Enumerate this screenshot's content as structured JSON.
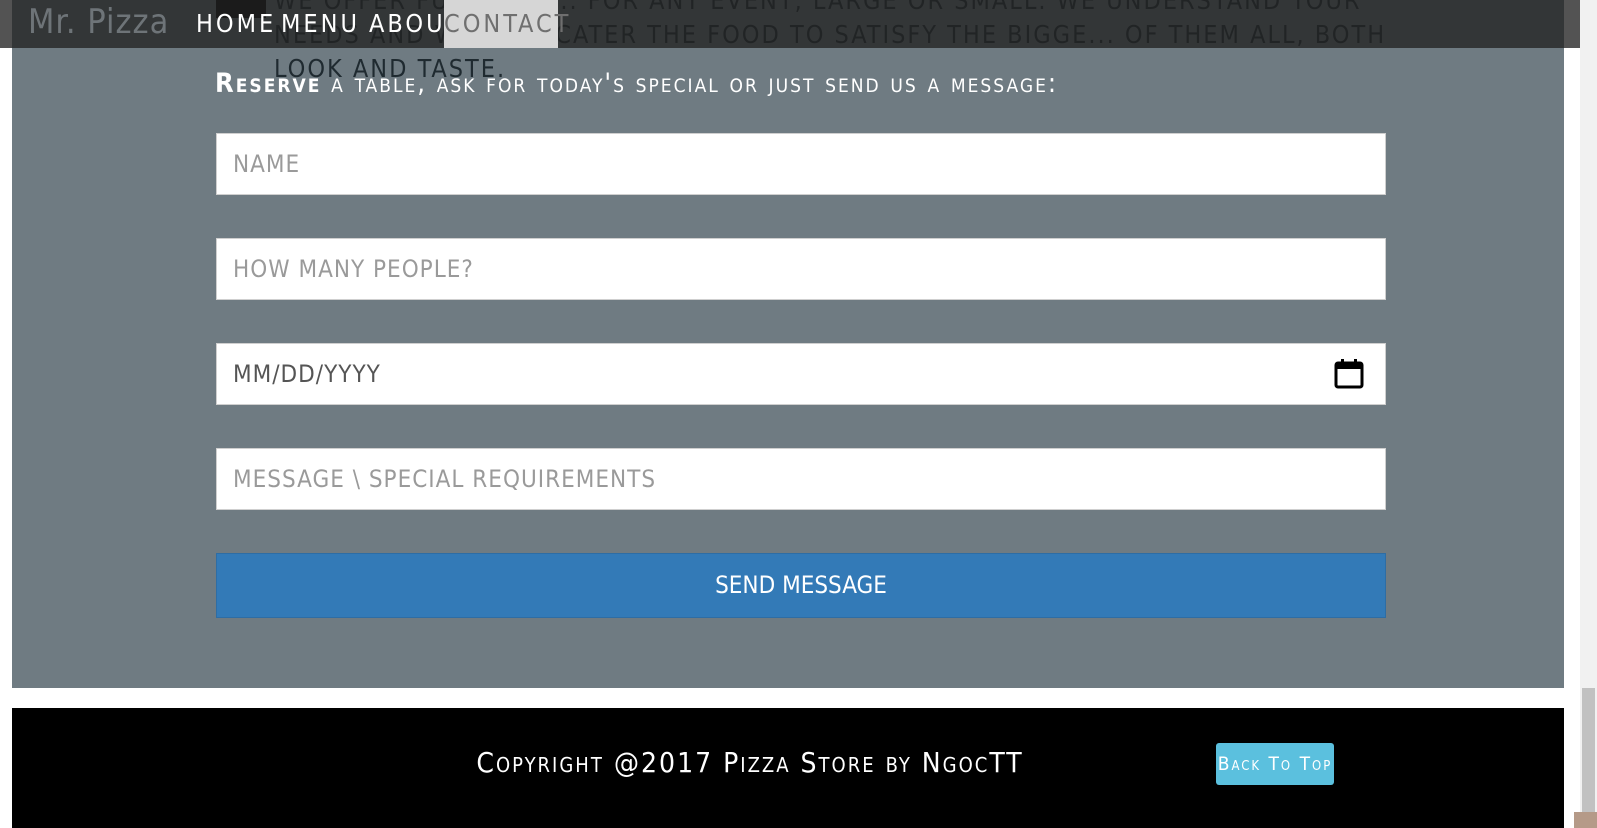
{
  "app": {
    "brand": "Mr. Pizza"
  },
  "nav": {
    "items": [
      {
        "label": "HOME"
      },
      {
        "label": "MENU"
      },
      {
        "label": "ABOUT"
      },
      {
        "label": "CONTACT",
        "active": true
      }
    ]
  },
  "intro": {
    "text": "We offer full-serv... for any event, large or small. We understand your needs and we will cater the food to satisfy the bigge... of them all, both look and taste."
  },
  "reserve": {
    "strong": "Reserve",
    "text": " a table, ask for today's special or just send us a message:"
  },
  "form": {
    "name_placeholder": "NAME",
    "people_placeholder": "HOW MANY PEOPLE?",
    "date_placeholder": "mm/dd/yyyy",
    "message_placeholder": "MESSAGE \\ SPECIAL REQUIREMENTS",
    "send_label": "SEND MESSAGE"
  },
  "footer": {
    "copyright": "Copyright @2017 Pizza Store by NgocTT",
    "back_to_top": "Back To Top"
  },
  "colors": {
    "section_bg": "#6f7b82",
    "send_button": "#337ab7",
    "back_to_top": "#5bc0de",
    "footer_bg": "#000000",
    "nav_active_bg": "#d6d6d6"
  }
}
